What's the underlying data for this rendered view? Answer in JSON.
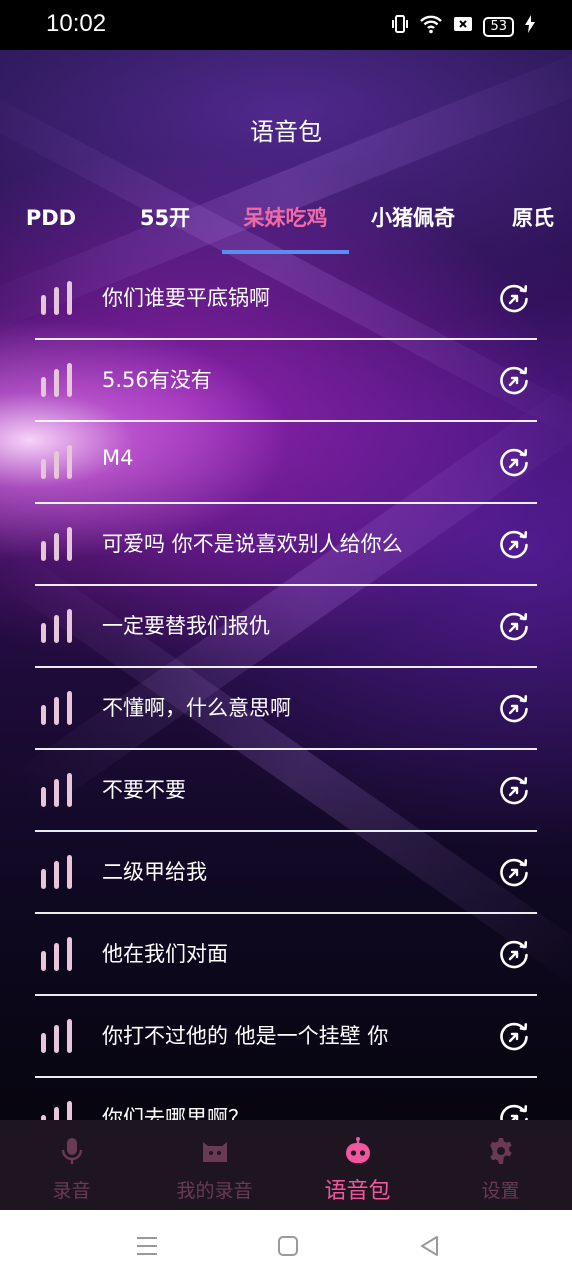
{
  "status_bar": {
    "time": "10:02",
    "battery": "53"
  },
  "header": {
    "title": "语音包"
  },
  "tabs": [
    {
      "label": "PDD"
    },
    {
      "label": "55开"
    },
    {
      "label": "呆妹吃鸡",
      "active": true
    },
    {
      "label": "小猪佩奇"
    },
    {
      "label": "原氏"
    }
  ],
  "clips": [
    {
      "text": "你们谁要平底锅啊"
    },
    {
      "text": "5.56有没有"
    },
    {
      "text": "M4"
    },
    {
      "text": "可爱吗 你不是说喜欢别人给你么"
    },
    {
      "text": "一定要替我们报仇"
    },
    {
      "text": "不懂啊，什么意思啊"
    },
    {
      "text": "不要不要"
    },
    {
      "text": "二级甲给我"
    },
    {
      "text": "他在我们对面"
    },
    {
      "text": "你打不过他的 他是一个挂壁 你"
    },
    {
      "text": "你们去哪里啊？"
    }
  ],
  "bottom_nav": [
    {
      "label": "录音",
      "icon": "microphone-icon"
    },
    {
      "label": "我的录音",
      "icon": "folder-cat-icon"
    },
    {
      "label": "语音包",
      "icon": "bot-face-icon",
      "active": true
    },
    {
      "label": "设置",
      "icon": "gear-icon"
    }
  ],
  "colors": {
    "accent_pink": "#f0579e",
    "tab_active": "#ef6aa7",
    "tab_underline": "#5b8cf0",
    "nav_inactive": "#6a3a55",
    "bars": "#e7c6dc"
  }
}
